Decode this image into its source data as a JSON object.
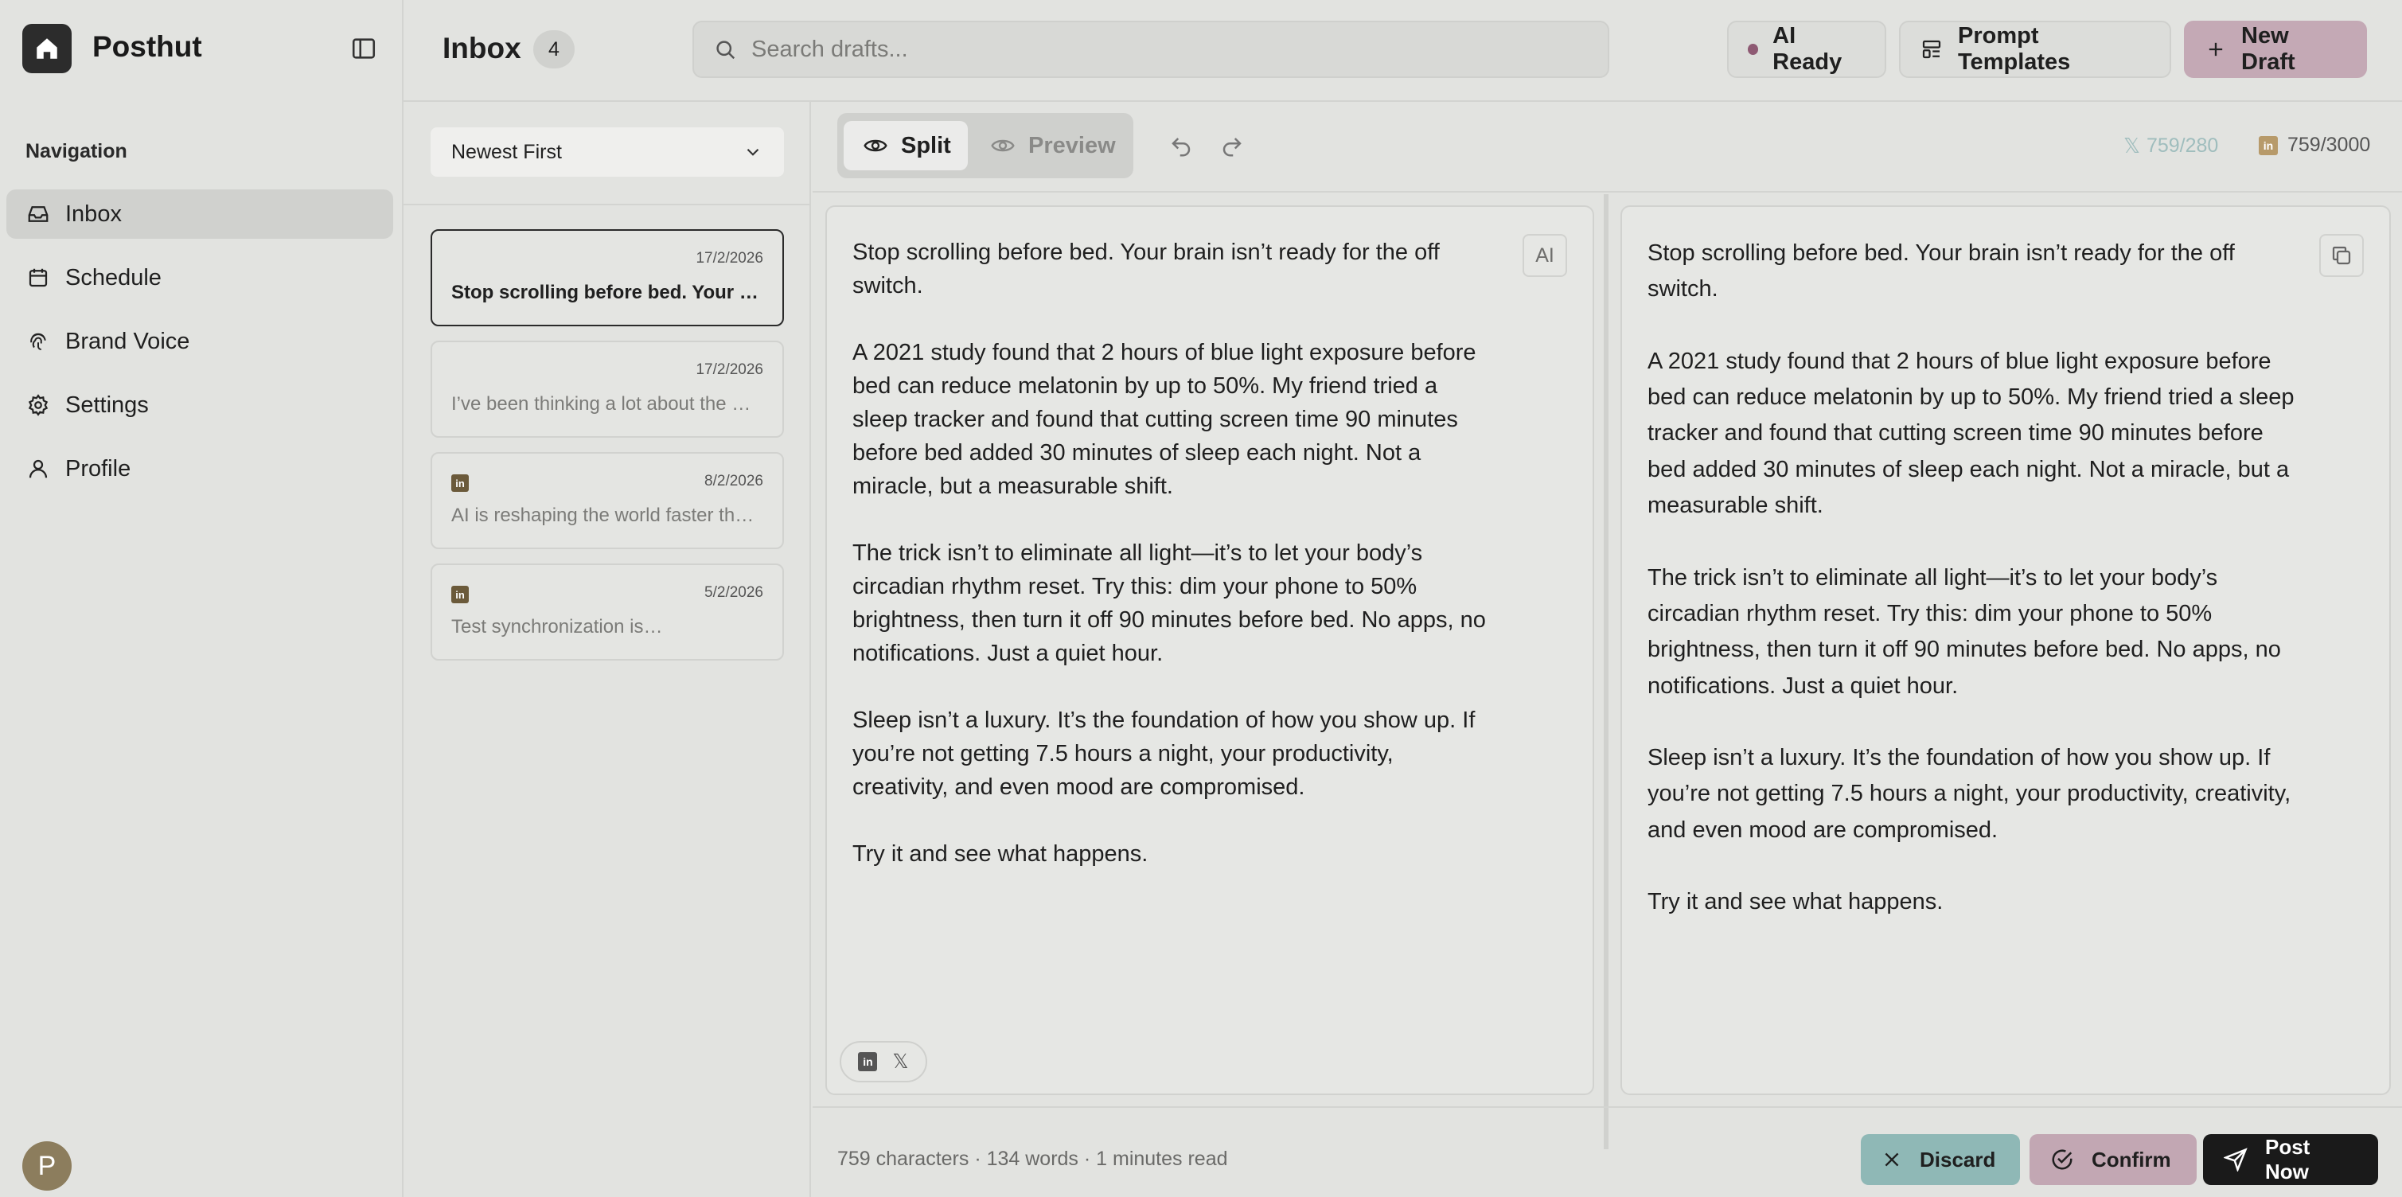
{
  "app": {
    "name": "Posthut"
  },
  "sidebar": {
    "heading": "Navigation",
    "items": [
      {
        "label": "Inbox",
        "icon": "inbox-icon",
        "active": true
      },
      {
        "label": "Schedule",
        "icon": "calendar-icon"
      },
      {
        "label": "Brand Voice",
        "icon": "fingerprint-icon"
      },
      {
        "label": "Settings",
        "icon": "gear-icon"
      },
      {
        "label": "Profile",
        "icon": "user-icon"
      }
    ],
    "avatar_initial": "P"
  },
  "header": {
    "title": "Inbox",
    "count": "4",
    "search_placeholder": "Search drafts...",
    "ai_status": "AI Ready",
    "templates_label": "Prompt Templates",
    "new_draft_label": "New Draft"
  },
  "list": {
    "sort_value": "Newest First",
    "drafts": [
      {
        "date": "17/2/2026",
        "text": "Stop scrolling before bed. Your brain isn’t ready for the off switch.",
        "platform": "",
        "selected": true
      },
      {
        "date": "17/2/2026",
        "text": "I’ve been thinking a lot about the way we work",
        "platform": ""
      },
      {
        "date": "8/2/2026",
        "text": "AI is reshaping the world faster than we think",
        "platform": "linkedin"
      },
      {
        "date": "5/2/2026",
        "text": "Test synchronization is…",
        "platform": "linkedin"
      }
    ]
  },
  "editor": {
    "mode_split": "Split",
    "mode_preview": "Preview",
    "x_count": "759/280",
    "linkedin_count": "759/3000",
    "ai_badge": "AI",
    "editor_text": "Stop scrolling before bed. Your brain isn’t ready for the off switch.\n\nA 2021 study found that 2 hours of blue light exposure before bed can reduce melatonin by up to 50%. My friend tried a sleep tracker and found that cutting screen time 90 minutes before bed added 30 minutes of sleep each night. Not a miracle, but a measurable shift.\n\nThe trick isn’t to eliminate all light—it’s to let your body’s circadian rhythm reset. Try this: dim your phone to 50% brightness, then turn it off 90 minutes before bed. No apps, no notifications. Just a quiet hour.\n\nSleep isn’t a luxury. It’s the foundation of how you show up. If you’re not getting 7.5 hours a night, your productivity, creativity, and even mood are compromised.\n\nTry it and see what happens.",
    "preview_text": "Stop scrolling before bed. Your brain isn’t ready for the off switch.\n\nA 2021 study found that 2 hours of blue light exposure before bed can reduce melatonin by up to 50%. My friend tried a sleep tracker and found that cutting screen time 90 minutes before bed added 30 minutes of sleep each night. Not a miracle, but a measurable shift.\n\nThe trick isn’t to eliminate all light—it’s to let your body’s circadian rhythm reset. Try this: dim your phone to 50% brightness, then turn it off 90 minutes before bed. No apps, no notifications. Just a quiet hour.\n\nSleep isn’t a luxury. It’s the foundation of how you show up. If you’re not getting 7.5 hours a night, your productivity, creativity, and even mood are compromised.\n\nTry it and see what happens.",
    "platform_x": "𝕏"
  },
  "footer": {
    "stats": "759 characters · 134 words · 1 minutes read",
    "discard_label": "Discard",
    "confirm_label": "Confirm",
    "post_label": "Post Now"
  },
  "colors": {
    "background": "#e2e3e0",
    "accent_plum": "#c4a9b5",
    "discard_teal": "#8fb8b6",
    "post_dark": "#1a1a1a",
    "ai_dot": "#8e5a73"
  }
}
